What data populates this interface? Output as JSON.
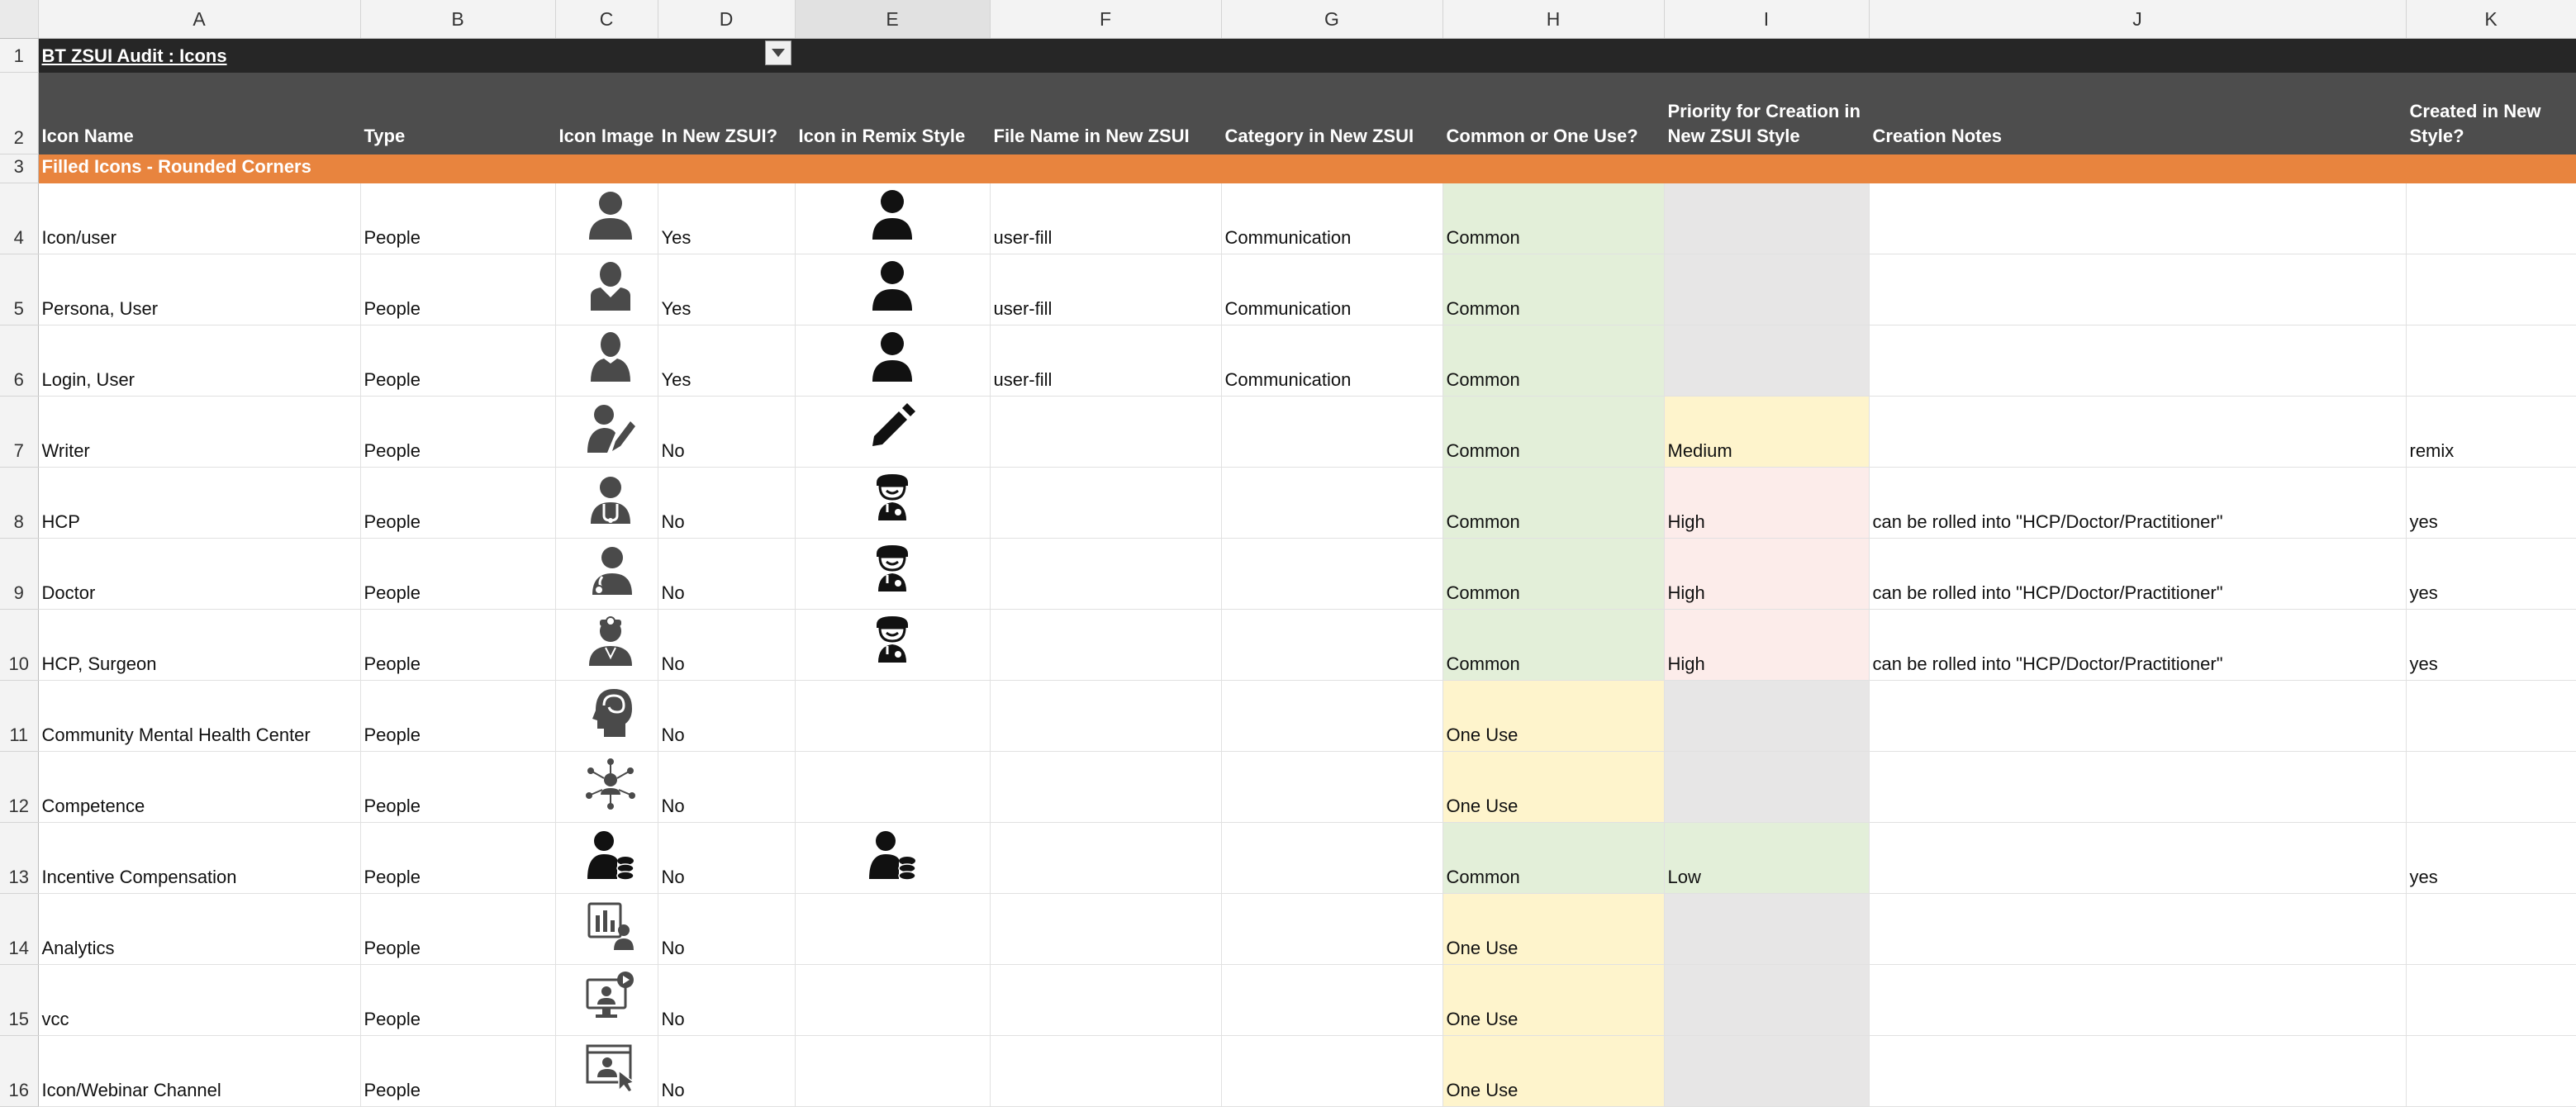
{
  "columns": [
    "A",
    "B",
    "C",
    "D",
    "E",
    "F",
    "G",
    "H",
    "I",
    "J",
    "K"
  ],
  "title": "BT ZSUI Audit : Icons",
  "headers": {
    "icon_name": "Icon Name",
    "type": "Type",
    "icon_image": "Icon Image",
    "in_new": "In New ZSUI?",
    "remix": "Icon in Remix Style",
    "file_name": "File Name in New ZSUI",
    "category": "Category in New ZSUI",
    "common": "Common or One Use?",
    "priority_line1": "Priority for Creation in",
    "priority_line2": "New ZSUI Style",
    "notes": "Creation Notes",
    "created_line1": "Created in New",
    "created_line2": "Style?"
  },
  "section": "Filled Icons - Rounded Corners",
  "rows": [
    {
      "num": "4",
      "name": "Icon/user",
      "type": "People",
      "icon": "user-icon",
      "in_new": "Yes",
      "remix": "user-fill-icon",
      "file": "user-fill",
      "category": "Communication",
      "common": "Common",
      "priority": "",
      "notes": "",
      "created": ""
    },
    {
      "num": "5",
      "name": "Persona, User",
      "type": "People",
      "icon": "persona-icon",
      "in_new": "Yes",
      "remix": "user-fill-icon",
      "file": "user-fill",
      "category": "Communication",
      "common": "Common",
      "priority": "",
      "notes": "",
      "created": ""
    },
    {
      "num": "6",
      "name": "Login, User",
      "type": "People",
      "icon": "login-user-icon",
      "in_new": "Yes",
      "remix": "user-fill-icon",
      "file": "user-fill",
      "category": "Communication",
      "common": "Common",
      "priority": "",
      "notes": "",
      "created": ""
    },
    {
      "num": "7",
      "name": "Writer",
      "type": "People",
      "icon": "writer-icon",
      "in_new": "No",
      "remix": "pencil-icon",
      "file": "",
      "category": "",
      "common": "Common",
      "priority": "Medium",
      "notes": "",
      "created": "remix"
    },
    {
      "num": "8",
      "name": "HCP",
      "type": "People",
      "icon": "hcp-icon",
      "in_new": "No",
      "remix": "doctor-icon",
      "file": "",
      "category": "",
      "common": "Common",
      "priority": "High",
      "notes": "can be rolled into \"HCP/Doctor/Practitioner\"",
      "created": "yes"
    },
    {
      "num": "9",
      "name": "Doctor",
      "type": "People",
      "icon": "doctor-stethoscope-icon",
      "in_new": "No",
      "remix": "doctor-icon",
      "file": "",
      "category": "",
      "common": "Common",
      "priority": "High",
      "notes": "can be rolled into \"HCP/Doctor/Practitioner\"",
      "created": "yes"
    },
    {
      "num": "10",
      "name": "HCP, Surgeon",
      "type": "People",
      "icon": "surgeon-icon",
      "in_new": "No",
      "remix": "doctor-icon",
      "file": "",
      "category": "",
      "common": "Common",
      "priority": "High",
      "notes": "can be rolled into \"HCP/Doctor/Practitioner\"",
      "created": "yes"
    },
    {
      "num": "11",
      "name": "Community Mental Health Center",
      "type": "People",
      "icon": "brain-head-icon",
      "in_new": "No",
      "remix": "",
      "file": "",
      "category": "",
      "common": "One Use",
      "priority": "",
      "notes": "",
      "created": ""
    },
    {
      "num": "12",
      "name": "Competence",
      "type": "People",
      "icon": "network-person-icon",
      "in_new": "No",
      "remix": "",
      "file": "",
      "category": "",
      "common": "One Use",
      "priority": "",
      "notes": "",
      "created": ""
    },
    {
      "num": "13",
      "name": "Incentive Compensation",
      "type": "People",
      "icon": "person-coins-icon",
      "in_new": "No",
      "remix": "person-coins-icon",
      "file": "",
      "category": "",
      "common": "Common",
      "priority": "Low",
      "notes": "",
      "created": "yes"
    },
    {
      "num": "14",
      "name": "Analytics",
      "type": "People",
      "icon": "analytics-person-icon",
      "in_new": "No",
      "remix": "",
      "file": "",
      "category": "",
      "common": "One Use",
      "priority": "",
      "notes": "",
      "created": ""
    },
    {
      "num": "15",
      "name": "vcc",
      "type": "People",
      "icon": "video-call-icon",
      "in_new": "No",
      "remix": "",
      "file": "",
      "category": "",
      "common": "One Use",
      "priority": "",
      "notes": "",
      "created": ""
    },
    {
      "num": "16",
      "name": "Icon/Webinar Channel",
      "type": "People",
      "icon": "webinar-icon",
      "in_new": "No",
      "remix": "",
      "file": "",
      "category": "",
      "common": "One Use",
      "priority": "",
      "notes": "",
      "created": ""
    }
  ]
}
